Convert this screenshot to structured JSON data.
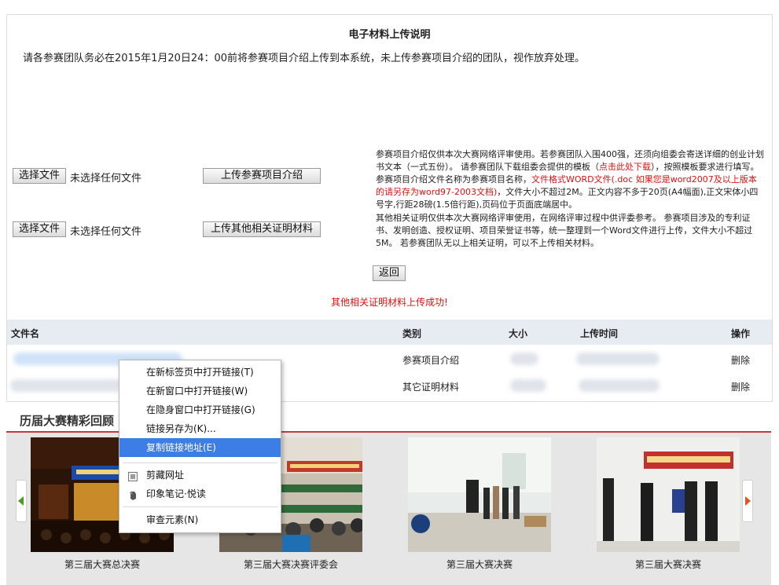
{
  "upload": {
    "title": "电子材料上传说明",
    "notice": "请各参赛团队务必在2015年1月20日24：00前将参赛项目介绍上传到本系统，未上传参赛项目介绍的团队，视作放弃处理。",
    "choose_file_label": "选择文件",
    "no_file_label": "未选择任何文件",
    "upload_intro_button": "上传参赛项目介绍",
    "upload_other_button": "上传其他相关证明材料",
    "desc1_a": "参赛项目介绍仅供本次大赛网络评审使用。若参赛团队入围400强，还须向组委会寄送详细的创业计划书文本（一式五份）。 请参赛团队下载组委会提供的模板（",
    "desc1_link": "点击此处下载",
    "desc1_b": "），按照模板要求进行填写。 参赛项目介绍文件名称为参赛项目名称，",
    "desc1_red": "文件格式WORD文件(.doc 如果您是word2007及以上版本的请另存为word97-2003文档)",
    "desc1_c": "，文件大小不超过2M。正文内容不多于20页(A4幅面),正文宋体小四号字,行距28磅(1.5倍行距),页码位于页面底端居中。",
    "desc2": "其他相关证明仅供本次大赛网络评审使用，在网络评审过程中供评委参考。 参赛项目涉及的专利证书、发明创造、授权证明、项目荣誉证书等，统一整理到一个Word文件进行上传，文件大小不超过5M。 若参赛团队无以上相关证明，可以不上传相关材料。",
    "back_button": "返回",
    "success_message": "其他相关证明材料上传成功!"
  },
  "table": {
    "headers": [
      "文件名",
      "类别",
      "大小",
      "上传时间",
      "操作"
    ],
    "rows": [
      {
        "category": "参赛项目介绍",
        "action": "删除"
      },
      {
        "category": "其它证明材料",
        "action": "删除"
      }
    ]
  },
  "gallery": {
    "title": "历届大赛精彩回顾",
    "captions": [
      "第三届大赛总决赛",
      "第三届大赛决赛评委会",
      "第三届大赛决赛",
      "第三届大赛决赛"
    ]
  },
  "context_menu": {
    "items": [
      {
        "label": "在新标签页中打开链接(T)"
      },
      {
        "label": "在新窗口中打开链接(W)"
      },
      {
        "label": "在隐身窗口中打开链接(G)"
      },
      {
        "label": "链接另存为(K)..."
      },
      {
        "label": "复制链接地址(E)",
        "selected": true
      },
      {
        "label": "剪藏网址",
        "icon": "clip-icon"
      },
      {
        "label": "印象笔记·悦读",
        "icon": "evernote-icon"
      },
      {
        "label": "审查元素(N)"
      }
    ]
  },
  "colors": {
    "accent_red": "#e01010",
    "menu_highlight": "#3d7ee6",
    "table_header_bg": "#e7ecf3",
    "gallery_rule": "#c63a3a"
  }
}
